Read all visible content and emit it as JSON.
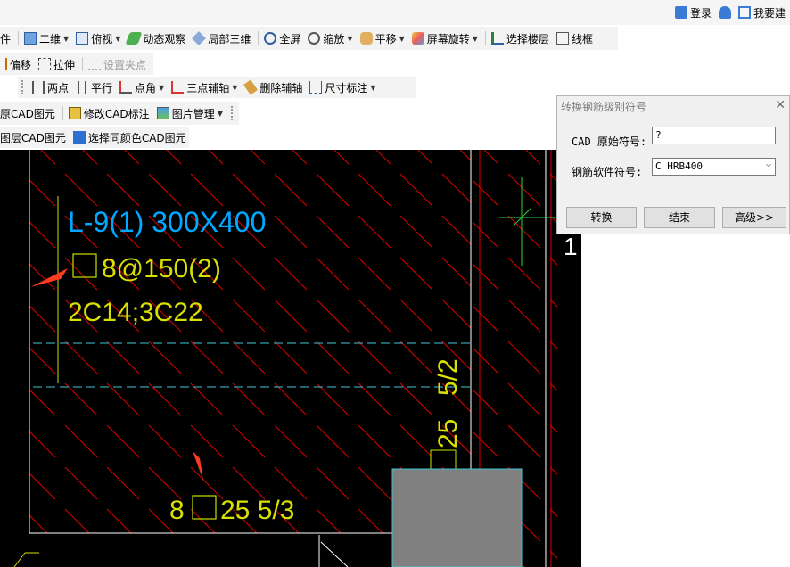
{
  "topbar": {
    "login": "登录",
    "build": "我要建"
  },
  "toolbar1": {
    "partial": "件",
    "view2d": "二维",
    "top_view": "俯视",
    "orbit": "动态观察",
    "local3d": "局部三维",
    "fullscreen": "全屏",
    "zoom": "缩放",
    "pan": "平移",
    "rotate": "屏幕旋转",
    "select_floor": "选择楼层",
    "wireframe": "线框"
  },
  "toolbar2": {
    "offset": "偏移",
    "stretch": "拉伸",
    "grip": "设置夹点"
  },
  "toolbar3": {
    "two_point": "两点",
    "parallel": "平行",
    "point_angle": "点角",
    "three_point": "三点辅轴",
    "delete_axis": "删除辅轴",
    "dimension": "尺寸标注"
  },
  "toolbar4": {
    "cad_item": "原CAD图元",
    "modify_cad": "修改CAD标注",
    "image_mgr": "图片管理"
  },
  "toolbar5": {
    "layer_cad": "图层CAD图元",
    "same_color": "选择同颜色CAD图元"
  },
  "cad": {
    "beam_title": "L-9(1) 300X400",
    "stirrup": "8@150(2)",
    "rebar": "2C14;3C22",
    "bottom_label_a": "8",
    "bottom_label_b": "25 5/3",
    "vertical_a": "25",
    "vertical_b": "5/2",
    "axis_label": "1"
  },
  "dialog": {
    "title": "转换钢筋级别符号",
    "cad_label": "CAD 原始符号:",
    "cad_value": "?",
    "soft_label": "钢筋软件符号:",
    "soft_value": "C HRB400",
    "btn_convert": "转换",
    "btn_end": "结束",
    "btn_advanced": "高级>>"
  },
  "colors": {
    "canvas": "#000000",
    "text_cyan": "#00a8ff",
    "text_yellow": "#d8e000",
    "hatch": "#e00000",
    "dash": "#3fc6d6",
    "gray_block": "#808080"
  }
}
